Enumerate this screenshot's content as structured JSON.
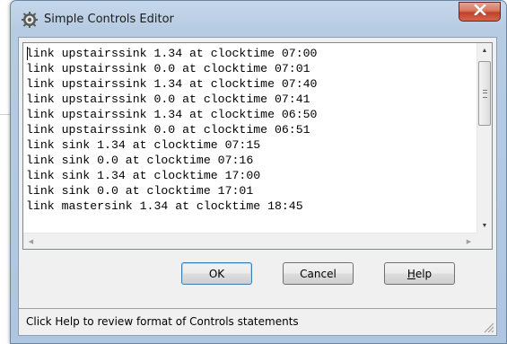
{
  "window": {
    "title": "Simple Controls Editor"
  },
  "editor": {
    "lines": [
      "link upstairssink 1.34 at clocktime 07:00",
      "link upstairssink 0.0 at clocktime 07:01",
      "link upstairssink 1.34 at clocktime 07:40",
      "link upstairssink 0.0 at clocktime 07:41",
      "link upstairssink 1.34 at clocktime 06:50",
      "link upstairssink 0.0 at clocktime 06:51",
      "link sink 1.34 at clocktime 07:15",
      "link sink 0.0 at clocktime 07:16",
      "link sink 1.34 at clocktime 17:00",
      "link sink 0.0 at clocktime 17:01",
      "link mastersink 1.34 at clocktime 18:45"
    ]
  },
  "buttons": {
    "ok": "OK",
    "cancel": "Cancel",
    "help_letter": "H",
    "help_rest": "elp"
  },
  "status": {
    "text": "Click Help to review format of Controls statements"
  },
  "icons": {
    "app": "gear-icon",
    "close": "close-icon",
    "size_grip": "resize-grip-icon"
  },
  "colors": {
    "close_button": "#c74a32",
    "titlebar": "#b9cde4",
    "default_button_border": "#3c7fb1"
  }
}
